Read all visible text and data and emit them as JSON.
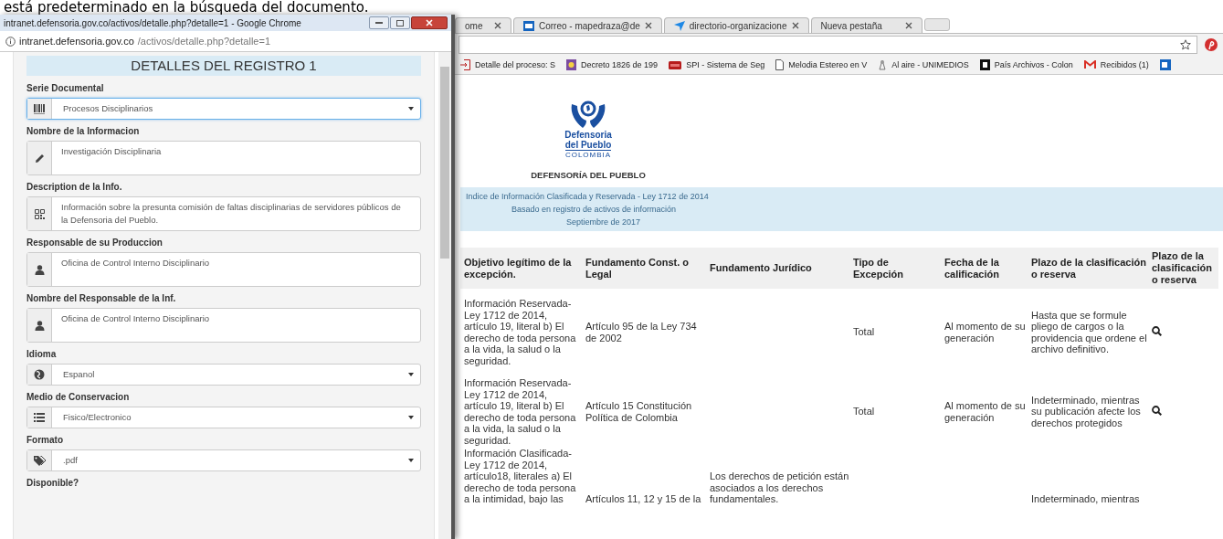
{
  "caption": "está predeterminado en la búsqueda del documento.",
  "popup": {
    "title": "intranet.defensoria.gov.co/activos/detalle.php?detalle=1 - Google Chrome",
    "url_host": "intranet.defensoria.gov.co",
    "url_path": "/activos/detalle.php?detalle=1",
    "heading": "DETALLES DEL REGISTRO 1",
    "fields": [
      {
        "label": "Serie Documental",
        "kind": "select",
        "value": "Procesos Disciplinarios",
        "focused": true
      },
      {
        "label": "Nombre de la Informacion",
        "kind": "textarea",
        "value": "Investigación Disciplinaria",
        "focused": false
      },
      {
        "label": "Description de la Info.",
        "kind": "textarea",
        "value": "Información sobre la presunta comisión de faltas disciplinarias de servidores públicos de la Defensoria del Pueblo.",
        "focused": false
      },
      {
        "label": "Responsable de su Produccion",
        "kind": "textarea",
        "value": "Oficina de Control Interno Disciplinario",
        "focused": false
      },
      {
        "label": "Nombre del Responsable de la Inf.",
        "kind": "textarea",
        "value": "Oficina de Control Interno Disciplinario",
        "focused": false
      },
      {
        "label": "Idioma",
        "kind": "select",
        "value": "Espanol",
        "focused": false
      },
      {
        "label": "Medio de Conservacion",
        "kind": "select",
        "value": "Fisico/Electronico",
        "focused": false
      },
      {
        "label": "Formato",
        "kind": "select",
        "value": ".pdf",
        "focused": false
      }
    ],
    "next_label": "Disponible?"
  },
  "browser": {
    "tabs": [
      {
        "label": "ome"
      },
      {
        "label": "Correo - mapedraza@de"
      },
      {
        "label": "directorio-organizacione"
      },
      {
        "label": "Nueva pestaña"
      }
    ],
    "bookmarks": [
      {
        "label": "Detalle del proceso: S"
      },
      {
        "label": "Decreto 1826 de 199"
      },
      {
        "label": "SPI - Sistema de Seg"
      },
      {
        "label": "Melodia Estereo en V"
      },
      {
        "label": "Al aire - UNIMEDIOS"
      },
      {
        "label": "País Archivos - Colon"
      },
      {
        "label": "Recibidos (1)"
      }
    ],
    "logo_lines": [
      "Defensoria",
      "del Pueblo",
      "COLOMBIA"
    ],
    "org_name": "DEFENSORÍA DEL PUEBLO",
    "banner_lines": [
      "Indice de Información Clasificada y Reservada - Ley 1712 de 2014",
      "Basado en registro de activos de información",
      "Septiembre de 2017"
    ],
    "table": {
      "columns": [
        "Objetivo legítimo de la excepción.",
        "Fundamento Const. o Legal",
        "Fundamento Jurídico",
        "Tipo de Excepción",
        "Fecha de la calificación",
        "Plazo de la clasificación o reserva",
        "Plazo de la clasificación o reserva"
      ],
      "rows": [
        {
          "cells": [
            "Información Reservada- Ley 1712 de 2014, artículo 19, literal b) El derecho de toda persona a la vida, la salud o la seguridad.",
            "Artículo 95 de la Ley 734 de 2002",
            null,
            "Total",
            "Al momento de su generación",
            "Hasta que se formule pliego de cargos o la providencia que ordene el archivo definitivo."
          ],
          "detail_link": true
        },
        {
          "cells": [
            "Información Reservada- Ley 1712 de 2014, artículo 19, literal b) El derecho de toda persona a la vida, la salud o la seguridad.",
            "Artículo 15 Constitución Política de Colombia",
            null,
            "Total",
            "Al momento de su generación",
            "Indeterminado, mientras su publicación afecte los derechos protegidos"
          ],
          "detail_link": true
        },
        {
          "cells": [
            "Información Clasificada- Ley 1712 de 2014, artículo18, literales a) El derecho de toda persona a la intimidad, bajo las",
            "Artículos 11, 12 y 15 de la",
            "Los derechos de petición están asociados a los derechos fundamentales.",
            null,
            null,
            "Indeterminado, mientras"
          ],
          "detail_link": false
        }
      ]
    }
  }
}
